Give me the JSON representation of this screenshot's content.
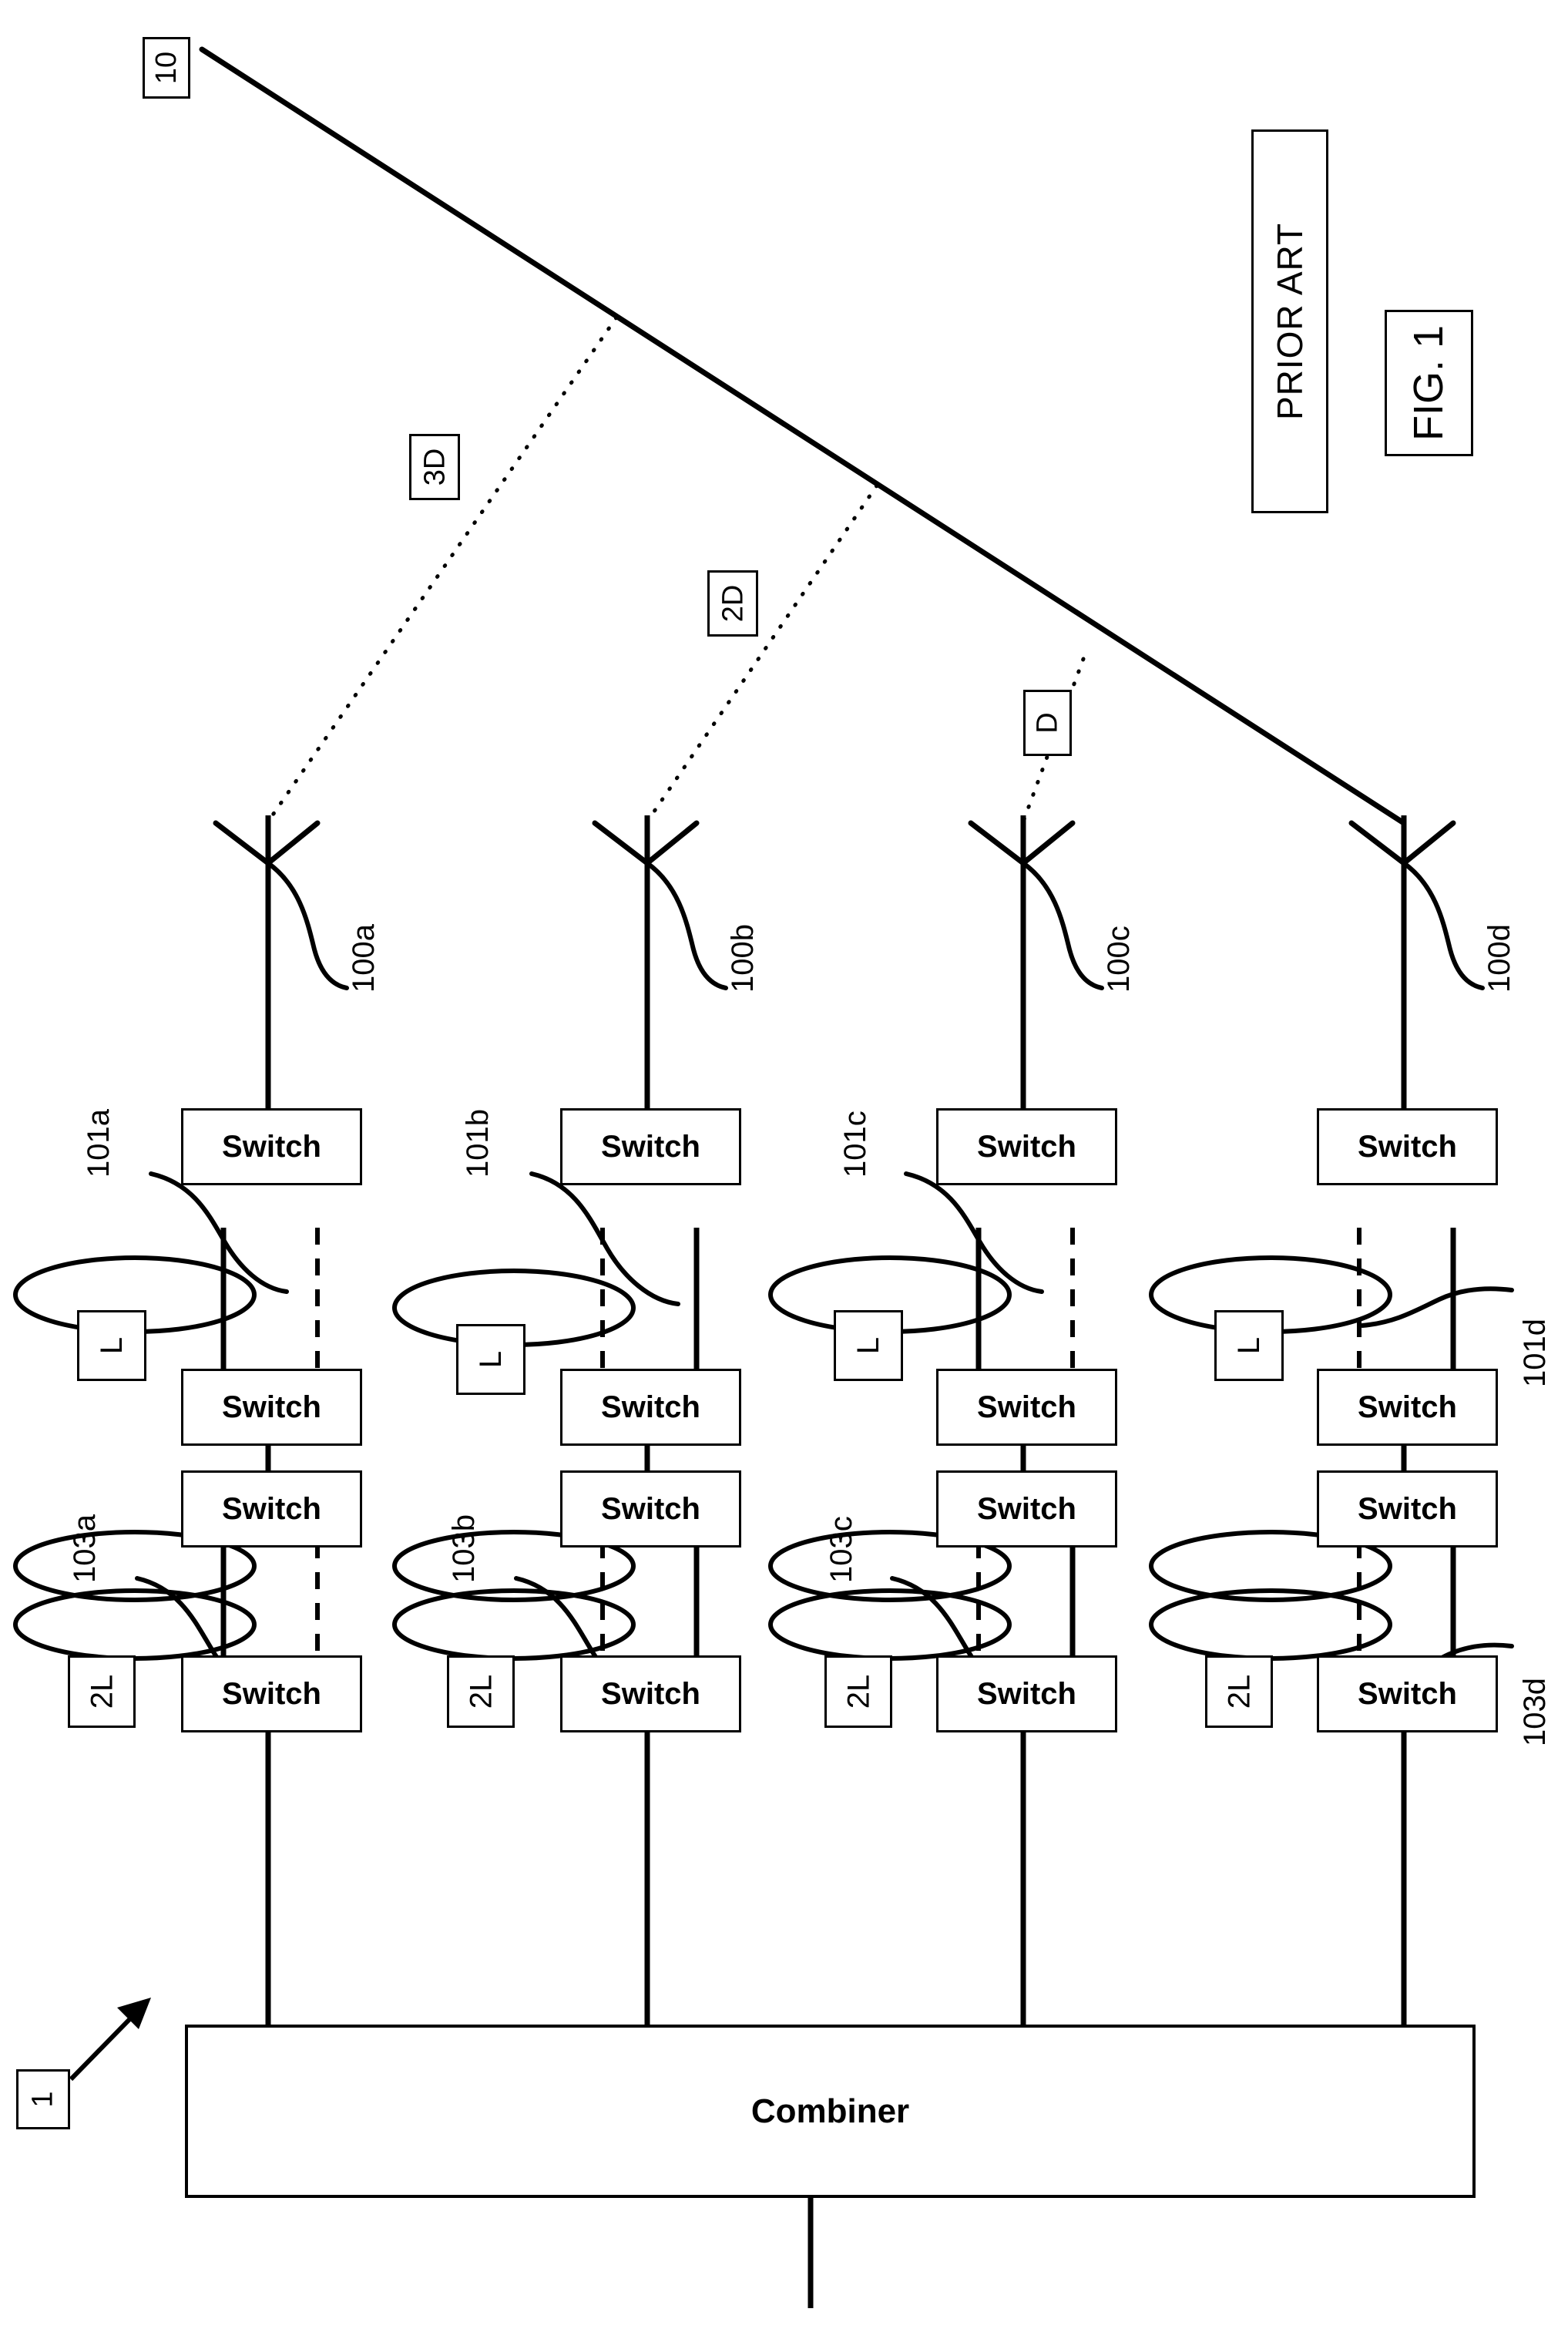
{
  "figure": {
    "figure_number_label": "FIG. 1",
    "prior_art_label": "PRIOR ART",
    "system_ref": "1",
    "wavefront_ref": "10",
    "combiner_label": "Combiner",
    "switch_label": "Switch"
  },
  "path_delta_labels": {
    "d1": "D",
    "d2": "2D",
    "d3": "3D"
  },
  "antennas": [
    {
      "ref": "100a"
    },
    {
      "ref": "100b"
    },
    {
      "ref": "100c"
    },
    {
      "ref": "100d"
    }
  ],
  "delay_lines_L": [
    {
      "ref": "101a",
      "value": "L"
    },
    {
      "ref": "101b",
      "value": "L"
    },
    {
      "ref": "101c",
      "value": "L"
    },
    {
      "ref": "101d",
      "value": "L"
    }
  ],
  "delay_lines_2L": [
    {
      "ref": "103a",
      "value": "2L"
    },
    {
      "ref": "103b",
      "value": "2L"
    },
    {
      "ref": "103c",
      "value": "2L"
    },
    {
      "ref": "103d",
      "value": "2L"
    }
  ],
  "branches": [
    {
      "id": "a",
      "switches": [
        "Switch",
        "Switch",
        "Switch",
        "Switch"
      ]
    },
    {
      "id": "b",
      "switches": [
        "Switch",
        "Switch",
        "Switch",
        "Switch"
      ]
    },
    {
      "id": "c",
      "switches": [
        "Switch",
        "Switch",
        "Switch",
        "Switch"
      ]
    },
    {
      "id": "d",
      "switches": [
        "Switch",
        "Switch",
        "Switch",
        "Switch"
      ]
    }
  ]
}
